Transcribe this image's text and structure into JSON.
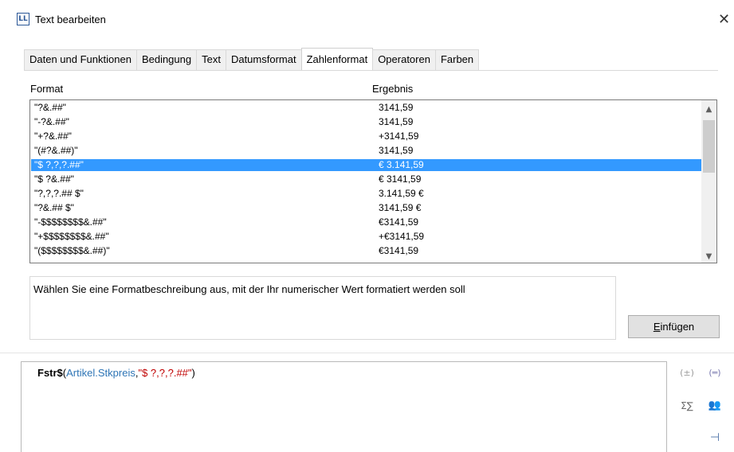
{
  "window": {
    "icon_text": "LL",
    "title": "Text bearbeiten",
    "close_glyph": "✕"
  },
  "tabs": [
    {
      "label": "Daten und Funktionen",
      "active": false
    },
    {
      "label": "Bedingung",
      "active": false
    },
    {
      "label": "Text",
      "active": false
    },
    {
      "label": "Datumsformat",
      "active": false
    },
    {
      "label": "Zahlenformat",
      "active": true
    },
    {
      "label": "Operatoren",
      "active": false
    },
    {
      "label": "Farben",
      "active": false
    }
  ],
  "list": {
    "header_format": "Format",
    "header_result": "Ergebnis",
    "rows": [
      {
        "format": "\"?&.##\"",
        "result": "3141,59",
        "selected": false
      },
      {
        "format": "\"-?&.##\"",
        "result": " 3141,59",
        "selected": false
      },
      {
        "format": "\"+?&.##\"",
        "result": "+3141,59",
        "selected": false
      },
      {
        "format": "\"(#?&.##)\"",
        "result": " 3141,59",
        "selected": false
      },
      {
        "format": "\"$ ?,?,?.##\"",
        "result": "€ 3.141,59",
        "selected": true
      },
      {
        "format": "\"$ ?&.##\"",
        "result": "€ 3141,59",
        "selected": false
      },
      {
        "format": "\"?,?,?.## $\"",
        "result": "3.141,59 €",
        "selected": false
      },
      {
        "format": "\"?&.## $\"",
        "result": "3141,59 €",
        "selected": false
      },
      {
        "format": "\"-$$$$$$$$&.##\"",
        "result": "€3141,59",
        "selected": false
      },
      {
        "format": "\"+$$$$$$$$&.##\"",
        "result": "+€3141,59",
        "selected": false
      },
      {
        "format": "\"($$$$$$$$&.##)\"",
        "result": "€3141,59",
        "selected": false
      }
    ],
    "scroll_up_glyph": "▲",
    "scroll_down_glyph": "▼"
  },
  "description": "Wählen Sie eine Formatbeschreibung aus, mit der Ihr numerischer Wert formatiert werden soll",
  "insert_button": {
    "accel": "E",
    "rest": "infügen"
  },
  "editor": {
    "function": "Fstr$",
    "open_paren": "(",
    "field": "Artikel.Stkpreis",
    "comma": ",",
    "string_arg": "\"$ ?,?,?.##\"",
    "close_paren": ")"
  },
  "tools": {
    "bracket_glyph": "(±)",
    "box_glyph": "(═)",
    "sigma_glyph": "Σ∑",
    "users_glyph": "👥",
    "format_glyph": "⊣"
  }
}
